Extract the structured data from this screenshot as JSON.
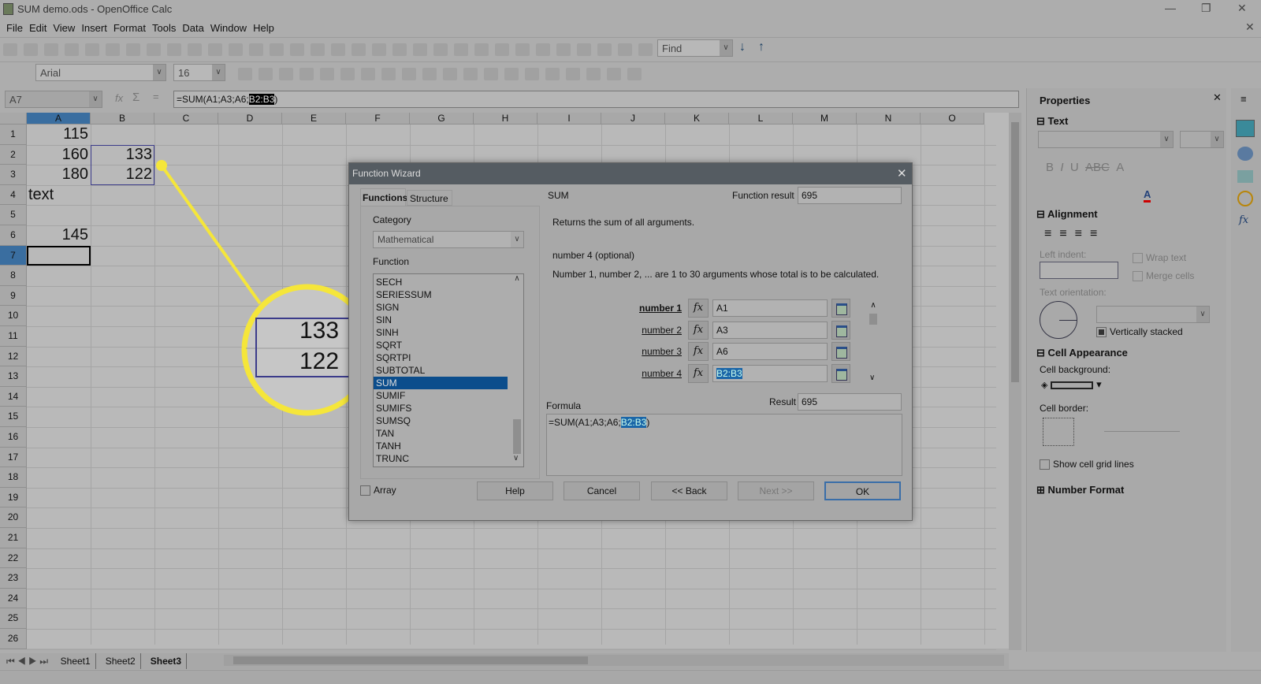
{
  "window": {
    "title": "SUM demo.ods - OpenOffice Calc"
  },
  "menu": [
    "File",
    "Edit",
    "View",
    "Insert",
    "Format",
    "Tools",
    "Data",
    "Window",
    "Help"
  ],
  "toolbar": {
    "find_placeholder": "Find",
    "font_name": "Arial",
    "font_size": "16"
  },
  "formula_bar": {
    "name_box": "A7",
    "formula": "=SUM(A1;A3;A6;",
    "formula_selected": "B2:B3",
    "formula_end": ")"
  },
  "grid": {
    "columns": [
      "A",
      "B",
      "C",
      "D",
      "E",
      "F",
      "G",
      "H",
      "I",
      "J",
      "K",
      "L",
      "M",
      "N",
      "O"
    ],
    "rows": [
      "1",
      "2",
      "3",
      "4",
      "5",
      "6",
      "7",
      "8",
      "9",
      "10",
      "11",
      "12",
      "13",
      "14",
      "15",
      "16",
      "17",
      "18",
      "19",
      "20",
      "21",
      "22",
      "23",
      "24",
      "25",
      "26"
    ],
    "cells": {
      "A1": "115",
      "A2": "160",
      "B2": "133",
      "A3": "180",
      "B3": "122",
      "A4": "text",
      "A6": "145"
    },
    "active_cell": "A7"
  },
  "callout": {
    "value1": "133",
    "value2": "122",
    "color": "#f5e63a"
  },
  "sheets": [
    "Sheet1",
    "Sheet2",
    "Sheet3"
  ],
  "active_sheet": "Sheet3",
  "dialog": {
    "title": "Function Wizard",
    "tabs": [
      "Functions",
      "Structure"
    ],
    "category_label": "Category",
    "category_value": "Mathematical",
    "function_label": "Function",
    "functions": [
      "SECH",
      "SERIESSUM",
      "SIGN",
      "SIN",
      "SINH",
      "SQRT",
      "SQRTPI",
      "SUBTOTAL",
      "SUM",
      "SUMIF",
      "SUMIFS",
      "SUMSQ",
      "TAN",
      "TANH",
      "TRUNC"
    ],
    "selected_function": "SUM",
    "function_name": "SUM",
    "function_result_label": "Function result",
    "function_result": "695",
    "description": "Returns the sum of all arguments.",
    "arg_title": "number 4 (optional)",
    "arg_description": "Number 1, number 2, ... are 1 to 30 arguments whose total is to be calculated.",
    "args": [
      {
        "label": "number 1",
        "value": "A1"
      },
      {
        "label": "number 2",
        "value": "A3"
      },
      {
        "label": "number 3",
        "value": "A6"
      },
      {
        "label": "number 4",
        "value": "B2:B3"
      }
    ],
    "fx_label": "fx",
    "formula_label": "Formula",
    "result_label": "Result",
    "result": "695",
    "formula_text": "=SUM(A1;A3;A6;",
    "formula_selected": "B2:B3",
    "formula_end": ")",
    "array_label": "Array",
    "buttons": {
      "help": "Help",
      "cancel": "Cancel",
      "back": "<< Back",
      "next": "Next >>",
      "ok": "OK"
    }
  },
  "properties": {
    "title": "Properties",
    "text_section": "Text",
    "alignment_section": "Alignment",
    "left_indent": "Left indent:",
    "wrap_text": "Wrap text",
    "merge_cells": "Merge cells",
    "text_orientation": "Text orientation:",
    "vertically_stacked": "Vertically stacked",
    "cell_appearance": "Cell Appearance",
    "cell_background": "Cell background:",
    "cell_border": "Cell border:",
    "show_grid": "Show cell grid lines",
    "number_format": "Number Format"
  }
}
